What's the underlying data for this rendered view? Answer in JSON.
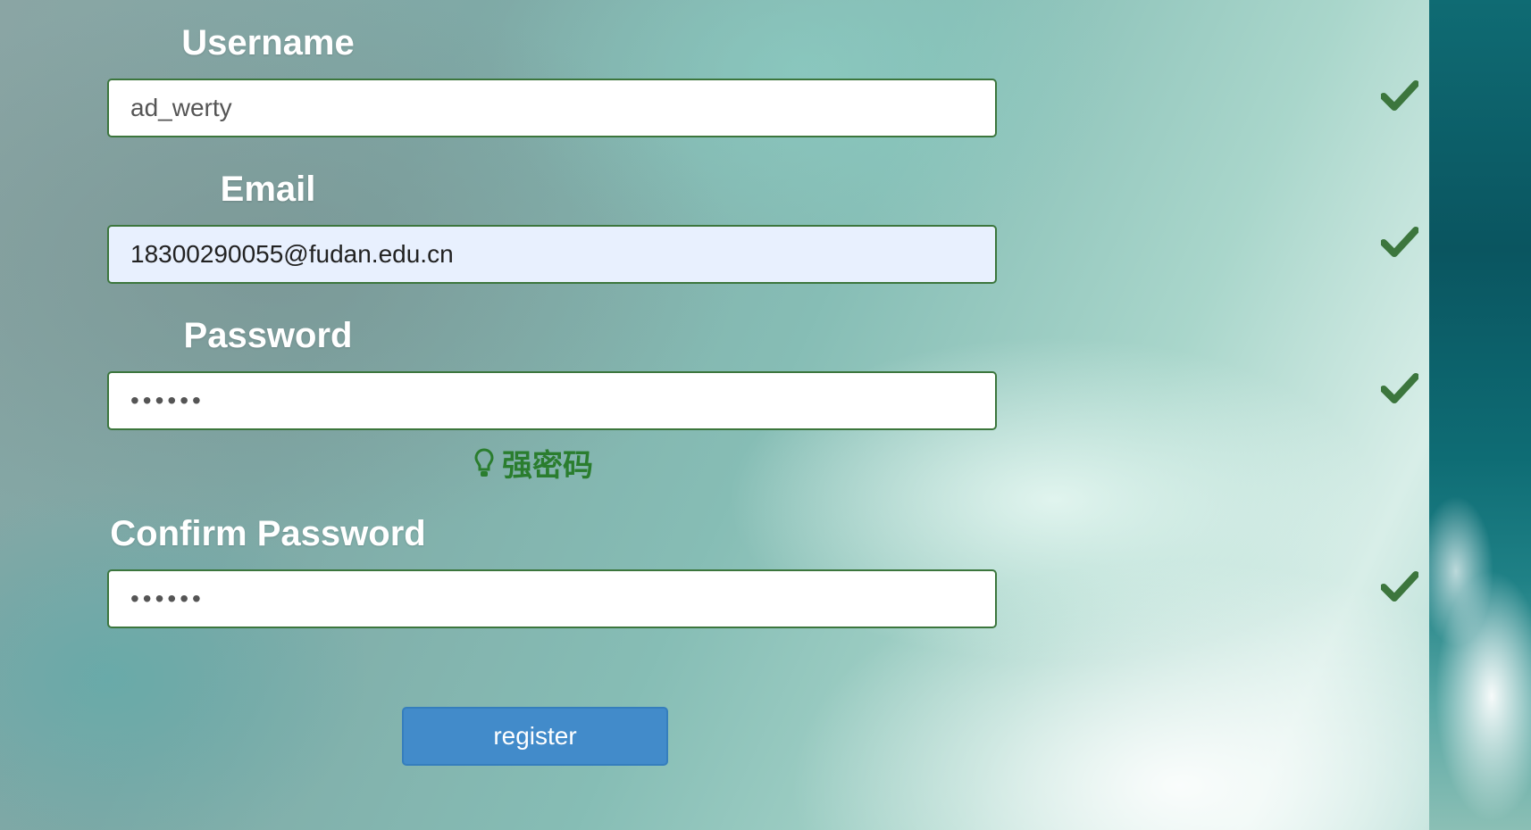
{
  "form": {
    "username": {
      "label": "Username",
      "value": "ad_werty"
    },
    "email": {
      "label": "Email",
      "value": "18300290055@fudan.edu.cn"
    },
    "password": {
      "label": "Password",
      "value": "••••••",
      "strength_hint": "强密码"
    },
    "confirm_password": {
      "label": "Confirm Password",
      "value": "••••••"
    },
    "register_label": "register"
  },
  "colors": {
    "success": "#3c763d",
    "hint": "#2a7d2e",
    "button": "#428bca"
  },
  "icons": {
    "validation": "checkmark-icon",
    "hint": "lightbulb-icon"
  }
}
